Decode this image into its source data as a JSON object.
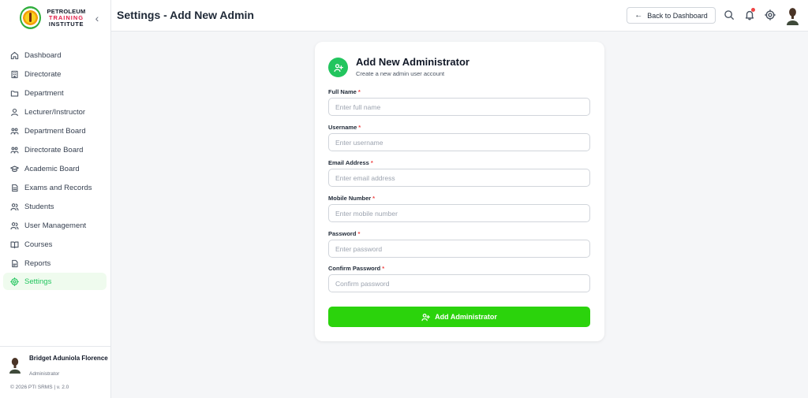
{
  "brand": {
    "line1": "PETROLEUM",
    "line2": "TRAINING",
    "line3": "INSTITUTE"
  },
  "header": {
    "title": "Settings - Add New Admin",
    "back_label": "Back to Dashboard"
  },
  "sidebar": {
    "items": [
      {
        "label": "Dashboard",
        "icon": "home-icon"
      },
      {
        "label": "Directorate",
        "icon": "building-icon"
      },
      {
        "label": "Department",
        "icon": "folder-icon"
      },
      {
        "label": "Lecturer/Instructor",
        "icon": "user-icon"
      },
      {
        "label": "Department Board",
        "icon": "users-group-icon"
      },
      {
        "label": "Directorate Board",
        "icon": "users-group-icon"
      },
      {
        "label": "Academic Board",
        "icon": "graduation-cap-icon"
      },
      {
        "label": "Exams and Records",
        "icon": "document-icon"
      },
      {
        "label": "Students",
        "icon": "users-icon"
      },
      {
        "label": "User Management",
        "icon": "users-icon"
      },
      {
        "label": "Courses",
        "icon": "book-icon"
      },
      {
        "label": "Reports",
        "icon": "report-icon"
      },
      {
        "label": "Settings",
        "icon": "gear-icon",
        "active": true
      }
    ]
  },
  "user": {
    "name": "Bridget Aduniola Florence",
    "role": "Administrator",
    "copyright": "© 2026 PTI SRMS | v. 2.0"
  },
  "form": {
    "title": "Add New Administrator",
    "subtitle": "Create a new admin user account",
    "fields": [
      {
        "label": "Full Name",
        "placeholder": "Enter full name"
      },
      {
        "label": "Username",
        "placeholder": "Enter username"
      },
      {
        "label": "Email Address",
        "placeholder": "Enter email address"
      },
      {
        "label": "Mobile Number",
        "placeholder": "Enter mobile number"
      },
      {
        "label": "Password",
        "placeholder": "Enter password"
      },
      {
        "label": "Confirm Password",
        "placeholder": "Confirm password"
      }
    ],
    "required_mark": "*",
    "submit_label": "Add Administrator"
  },
  "colors": {
    "accent": "#22c55e",
    "button": "#2bd30c",
    "notification": "#ef4444"
  }
}
